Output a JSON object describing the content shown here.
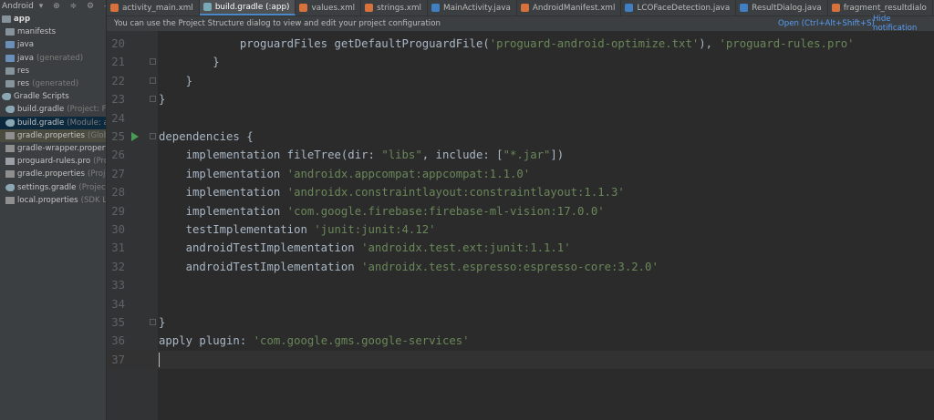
{
  "project": {
    "view_label": "Android",
    "root": "app",
    "items": [
      {
        "name": "manifests",
        "hint": "",
        "icon": "folder-icon"
      },
      {
        "name": "java",
        "hint": "",
        "icon": "folder-icon"
      },
      {
        "name": "java",
        "hint": "(generated)",
        "icon": "folder-icon"
      },
      {
        "name": "res",
        "hint": "",
        "icon": "folder-icon"
      },
      {
        "name": "res",
        "hint": "(generated)",
        "icon": "folder-icon"
      },
      {
        "name": "Gradle Scripts",
        "hint": "",
        "icon": "gradle-icon"
      },
      {
        "name": "build.gradle",
        "hint": "(Project: Face",
        "icon": "gradle-icon"
      },
      {
        "name": "build.gradle",
        "hint": "(Module: app",
        "icon": "gradle-icon"
      },
      {
        "name": "gradle.properties",
        "hint": "(Global",
        "icon": "properties-icon"
      },
      {
        "name": "gradle-wrapper.properties",
        "hint": "",
        "icon": "properties-icon"
      },
      {
        "name": "proguard-rules.pro",
        "hint": "(ProG",
        "icon": "proguard-icon"
      },
      {
        "name": "gradle.properties",
        "hint": "(Project",
        "icon": "properties-icon"
      },
      {
        "name": "settings.gradle",
        "hint": "(Project Se",
        "icon": "gradle-icon"
      },
      {
        "name": "local.properties",
        "hint": "(SDK Loc",
        "icon": "properties-icon"
      }
    ]
  },
  "tabs": [
    {
      "label": "activity_main.xml",
      "type": "xml"
    },
    {
      "label": "build.gradle (:app)",
      "type": "gradle",
      "active": true
    },
    {
      "label": "values.xml",
      "type": "xml"
    },
    {
      "label": "strings.xml",
      "type": "xml"
    },
    {
      "label": "MainActivity.java",
      "type": "java"
    },
    {
      "label": "AndroidManifest.xml",
      "type": "xml"
    },
    {
      "label": "LCOFaceDetection.java",
      "type": "java"
    },
    {
      "label": "ResultDialog.java",
      "type": "java"
    },
    {
      "label": "fragment_resultdialo",
      "type": "xml"
    }
  ],
  "notification": {
    "message": "You can use the Project Structure dialog to view and edit your project configuration",
    "open_link": "Open (Ctrl+Alt+Shift+S)",
    "hide_link": "Hide notification"
  },
  "editor": {
    "lines": [
      {
        "n": "20",
        "code": "            proguardFiles getDefaultProguardFile(",
        "s1": "'proguard-android-optimize.txt'",
        "mid": "), ",
        "s2": "'proguard-rules.pro'",
        "end": ""
      },
      {
        "n": "21",
        "code": "        }",
        "s1": "",
        "mid": "",
        "s2": "",
        "end": ""
      },
      {
        "n": "22",
        "code": "    }",
        "s1": "",
        "mid": "",
        "s2": "",
        "end": ""
      },
      {
        "n": "23",
        "code": "}",
        "s1": "",
        "mid": "",
        "s2": "",
        "end": ""
      },
      {
        "n": "24",
        "code": "",
        "s1": "",
        "mid": "",
        "s2": "",
        "end": ""
      },
      {
        "n": "25",
        "code": "dependencies {",
        "s1": "",
        "mid": "",
        "s2": "",
        "end": ""
      },
      {
        "n": "26",
        "code": "    implementation fileTree(dir: ",
        "s1": "\"libs\"",
        "mid": ", include: [",
        "s2": "\"*.jar\"",
        "end": "])"
      },
      {
        "n": "27",
        "code": "    implementation ",
        "s1": "'androidx.appcompat:appcompat:1.1.0'",
        "mid": "",
        "s2": "",
        "end": ""
      },
      {
        "n": "28",
        "code": "    implementation ",
        "s1": "'androidx.constraintlayout:constraintlayout:1.1.3'",
        "mid": "",
        "s2": "",
        "end": ""
      },
      {
        "n": "29",
        "code": "    implementation ",
        "s1": "'com.google.firebase:firebase-ml-vision:17.0.0'",
        "mid": "",
        "s2": "",
        "end": ""
      },
      {
        "n": "30",
        "code": "    testImplementation ",
        "s1": "'junit:junit:4.12'",
        "mid": "",
        "s2": "",
        "end": ""
      },
      {
        "n": "31",
        "code": "    androidTestImplementation ",
        "s1": "'androidx.test.ext:junit:1.1.1'",
        "mid": "",
        "s2": "",
        "end": ""
      },
      {
        "n": "32",
        "code": "    androidTestImplementation ",
        "s1": "'androidx.test.espresso:espresso-core:3.2.0'",
        "mid": "",
        "s2": "",
        "end": ""
      },
      {
        "n": "33",
        "code": "",
        "s1": "",
        "mid": "",
        "s2": "",
        "end": ""
      },
      {
        "n": "34",
        "code": "",
        "s1": "",
        "mid": "",
        "s2": "",
        "end": ""
      },
      {
        "n": "35",
        "code": "}",
        "s1": "",
        "mid": "",
        "s2": "",
        "end": ""
      },
      {
        "n": "36",
        "code": "apply plugin: ",
        "s1": "'com.google.gms.google-services'",
        "mid": "",
        "s2": "",
        "end": ""
      },
      {
        "n": "37",
        "code": "",
        "s1": "",
        "mid": "",
        "s2": "",
        "end": ""
      }
    ]
  }
}
